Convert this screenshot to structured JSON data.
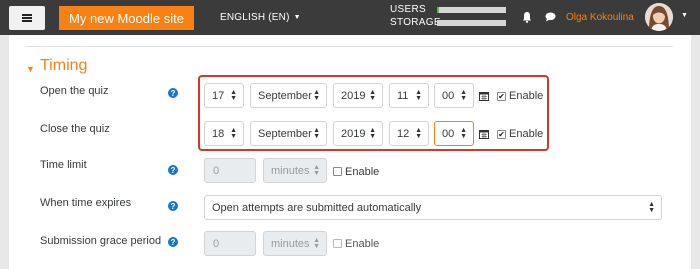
{
  "navbar": {
    "site_name": "My new Moodle site",
    "language": "ENGLISH (EN)",
    "users_label": "USERS",
    "storage_label": "STORAGE",
    "users_progress": 0.03,
    "storage_progress": 0.0,
    "user_name": "Olga Kokoulina",
    "menu_icon": "hamburger-icon",
    "bell_icon": "bell-icon",
    "chat_icon": "chat-icon"
  },
  "section": {
    "title": "Timing",
    "toggle_icon": "caret-down-icon"
  },
  "open_quiz": {
    "label": "Open the quiz",
    "day": "17",
    "month": "September",
    "year": "2019",
    "hour": "11",
    "minute": "00",
    "enable_label": "Enable",
    "enabled": true
  },
  "close_quiz": {
    "label": "Close the quiz",
    "day": "18",
    "month": "September",
    "year": "2019",
    "hour": "12",
    "minute": "00",
    "enable_label": "Enable",
    "enabled": true
  },
  "time_limit": {
    "label": "Time limit",
    "value": "0",
    "unit": "minutes",
    "enable_label": "Enable",
    "enabled": false
  },
  "when_expires": {
    "label": "When time expires",
    "value": "Open attempts are submitted automatically"
  },
  "grace_period": {
    "label": "Submission grace period",
    "value": "0",
    "unit": "minutes",
    "enable_label": "Enable",
    "enabled": false
  },
  "colors": {
    "accent": "#f98012",
    "navbar": "#3b3b3b",
    "help": "#1177d1",
    "highlight": "#d9362b"
  }
}
